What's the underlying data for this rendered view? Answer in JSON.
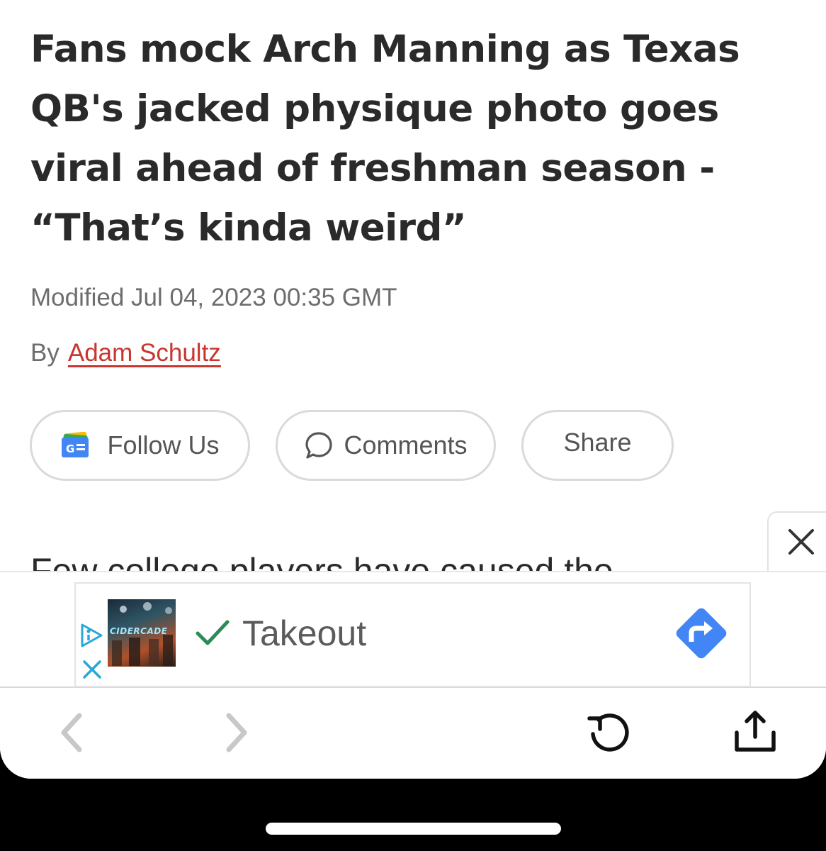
{
  "article": {
    "headline": "Fans mock Arch Manning as Texas QB's jacked physique photo goes viral ahead of freshman season - “That’s kinda weird”",
    "modified": "Modified Jul 04, 2023 00:35 GMT",
    "by_label": "By",
    "author": "Adam Schultz",
    "teaser": "Few college players have caused the"
  },
  "actions": {
    "follow_label": "Follow Us",
    "comments_label": "Comments",
    "share_label": "Share"
  },
  "ad": {
    "brand": "CIDERCADE",
    "text": "Takeout"
  },
  "colors": {
    "author_link": "#c8362f",
    "ad_check": "#2e8b57",
    "ad_arrow": "#4285f4"
  },
  "icons": [
    "google-news-icon",
    "comment-bubble-icon",
    "close-icon",
    "adchoices-icon",
    "checkmark-icon",
    "directions-arrow-icon",
    "back-icon",
    "forward-icon",
    "reload-icon",
    "share-icon"
  ]
}
